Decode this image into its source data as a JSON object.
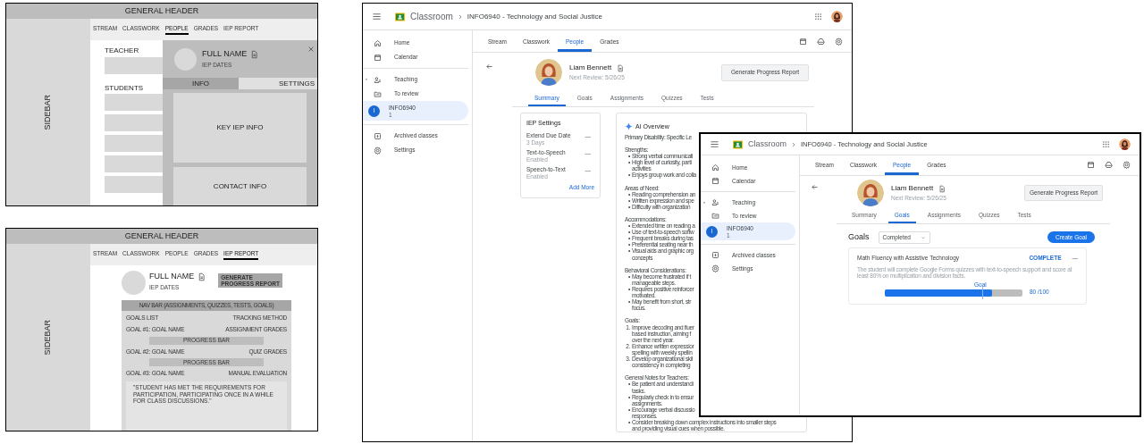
{
  "wireframes": [
    {
      "kind": "people",
      "header": "GENERAL HEADER",
      "sidebar": "SIDEBAR",
      "tabs": [
        {
          "label": "STREAM",
          "selected": false
        },
        {
          "label": "CLASSWORK",
          "selected": false
        },
        {
          "label": "PEOPLE",
          "selected": true
        },
        {
          "label": "GRADES",
          "selected": false
        },
        {
          "label": "IEP REPORT",
          "selected": false
        }
      ],
      "teacher_label": "TEACHER",
      "students_label": "STUDENTS",
      "profile": {
        "name": "FULL NAME",
        "dates": "IEP DATES"
      },
      "panel_tabs": [
        {
          "label": "INFO",
          "selected": true
        },
        {
          "label": "SETTINGS",
          "selected": false
        }
      ],
      "sections": [
        "KEY IEP INFO",
        "CONTACT INFO"
      ]
    },
    {
      "kind": "report",
      "header": "GENERAL HEADER",
      "sidebar": "SIDEBAR",
      "tabs": [
        {
          "label": "STREAM",
          "selected": false
        },
        {
          "label": "CLASSWORK",
          "selected": false
        },
        {
          "label": "PEOPLE",
          "selected": false
        },
        {
          "label": "GRADES",
          "selected": false
        },
        {
          "label": "IEP REPORT",
          "selected": true
        }
      ],
      "profile": {
        "name": "FULL NAME",
        "dates": "IEP DATES"
      },
      "button": "GENERATE PROGRESS REPORT",
      "nav_bar": "NAV BAR (ASSIGNMENTS, QUIZZES, TESTS, GOALS)",
      "goal_rows": [
        {
          "kind": "row",
          "left": "GOALS LIST",
          "right": "TRACKING METHOD"
        },
        {
          "kind": "row",
          "left": "GOAL #1: GOAL NAME",
          "right": "ASSIGNMENT GRADES"
        },
        {
          "kind": "bar",
          "label": "PROGRESS BAR"
        },
        {
          "kind": "row",
          "left": "GOAL #2: GOAL NAME",
          "right": "QUIZ GRADES"
        },
        {
          "kind": "bar",
          "label": "PROGRESS BAR"
        },
        {
          "kind": "row",
          "left": "GOAL #3: GOAL NAME",
          "right": "MANUAL EVALUATION"
        }
      ],
      "quote": "\"STUDENT HAS MET THE REQUIREMENTS FOR PARTICIPATION, PARTICIPATING ONCE IN A WHILE FOR CLASS DISCUSSIONS.\""
    }
  ],
  "screens": [
    {
      "kind": "summary",
      "app": "Classroom",
      "course": "INFO6940 - Technology and Social Justice",
      "sidebar": {
        "groups": [
          {
            "items": [
              {
                "label": "Home",
                "selected": false
              },
              {
                "label": "Calendar",
                "selected": false
              }
            ]
          },
          {
            "items": [
              {
                "label": "Teaching",
                "selected": false
              },
              {
                "label": "To review",
                "selected": false
              },
              {
                "label": "INFO6940",
                "sub": "1",
                "badge": "I",
                "selected": true
              }
            ]
          },
          {
            "items": [
              {
                "label": "Archived classes",
                "selected": false
              },
              {
                "label": "Settings",
                "selected": false
              }
            ]
          }
        ]
      },
      "tabs": [
        {
          "label": "Stream",
          "selected": false
        },
        {
          "label": "Classwork",
          "selected": false
        },
        {
          "label": "People",
          "selected": true
        },
        {
          "label": "Grades",
          "selected": false
        }
      ],
      "student": {
        "name": "Liam Bennett",
        "review": "Next Review: 5/26/25",
        "button": "Generate Progress Report"
      },
      "subtabs": [
        {
          "label": "Summary",
          "selected": true
        },
        {
          "label": "Goals",
          "selected": false
        },
        {
          "label": "Assignments",
          "selected": false
        },
        {
          "label": "Quizzes",
          "selected": false
        },
        {
          "label": "Tests",
          "selected": false
        }
      ],
      "iep_settings": {
        "title": "IEP Settings",
        "items": [
          {
            "label": "Extend Due Date",
            "sub": "3 Days",
            "value": "—"
          },
          {
            "label": "Text-to-Speech",
            "sub": "Enabled",
            "value": "—"
          },
          {
            "label": "Speech-to-Text",
            "sub": "Enabled",
            "value": "—"
          }
        ],
        "link": "Add More"
      },
      "ai_overview": {
        "title": "AI Overview",
        "primary": "Primary Disability: Specific Le",
        "sections": [
          {
            "heading": "Strengths:",
            "items": [
              {
                "marker": "•",
                "lines": [
                  "Strong verbal communicati"
                ]
              },
              {
                "marker": "•",
                "lines": [
                  "High level of curiosity, parti",
                  "activities"
                ]
              },
              {
                "marker": "•",
                "lines": [
                  "Enjoys group work and colla"
                ]
              }
            ]
          },
          {
            "heading": "Areas of Need:",
            "items": [
              {
                "marker": "•",
                "lines": [
                  "Reading comprehension an"
                ]
              },
              {
                "marker": "•",
                "lines": [
                  "Written expression and spe"
                ]
              },
              {
                "marker": "•",
                "lines": [
                  "Difficulty with organization"
                ]
              }
            ]
          },
          {
            "heading": "Accommodations:",
            "items": [
              {
                "marker": "•",
                "lines": [
                  "Extended time on reading a"
                ]
              },
              {
                "marker": "•",
                "lines": [
                  "Use of text-to-speech softw"
                ]
              },
              {
                "marker": "•",
                "lines": [
                  "Frequent breaks during tas"
                ]
              },
              {
                "marker": "•",
                "lines": [
                  "Preferential seating near th"
                ]
              },
              {
                "marker": "•",
                "lines": [
                  "Visual aids and graphic org",
                  "concepts"
                ]
              }
            ]
          },
          {
            "heading": "Behavioral Considerations:",
            "items": [
              {
                "marker": "•",
                "lines": [
                  "May become frustrated if t",
                  "manageable steps."
                ]
              },
              {
                "marker": "•",
                "lines": [
                  "Requires positive reinforcer",
                  "motivated."
                ]
              },
              {
                "marker": "•",
                "lines": [
                  "May benefit from short, str",
                  "focus."
                ]
              }
            ]
          },
          {
            "heading": "Goals:",
            "items": [
              {
                "marker": "1.",
                "lines": [
                  "Improve decoding and fluer",
                  "based instruction, aiming f",
                  "over the next year."
                ]
              },
              {
                "marker": "2.",
                "lines": [
                  "Enhance written expressior",
                  "spelling with weekly spellin"
                ]
              },
              {
                "marker": "3.",
                "lines": [
                  "Develop organizational skil",
                  "consistency in completing"
                ]
              }
            ]
          },
          {
            "heading": "General Notes for Teachers:",
            "items": [
              {
                "marker": "•",
                "lines": [
                  "Be patient and understandi",
                  "tasks."
                ]
              },
              {
                "marker": "•",
                "lines": [
                  "Regularly check in to ensur",
                  "assignments."
                ]
              },
              {
                "marker": "•",
                "lines": [
                  "Encourage verbal discussio",
                  "responses."
                ]
              },
              {
                "marker": "•",
                "lines": [
                  "Consider breaking down complex instructions into smaller steps",
                  "and providing visual cues when possible."
                ]
              }
            ]
          }
        ]
      }
    },
    {
      "kind": "goals",
      "app": "Classroom",
      "course": "INFO6940 - Technology and Social Justice",
      "sidebar": {
        "groups": [
          {
            "items": [
              {
                "label": "Home",
                "selected": false
              },
              {
                "label": "Calendar",
                "selected": false
              }
            ]
          },
          {
            "items": [
              {
                "label": "Teaching",
                "selected": false
              },
              {
                "label": "To review",
                "selected": false
              },
              {
                "label": "INFO6940",
                "sub": "1",
                "badge": "I",
                "selected": true
              }
            ]
          },
          {
            "items": [
              {
                "label": "Archived classes",
                "selected": false
              },
              {
                "label": "Settings",
                "selected": false
              }
            ]
          }
        ]
      },
      "tabs": [
        {
          "label": "Stream",
          "selected": false
        },
        {
          "label": "Classwork",
          "selected": false
        },
        {
          "label": "People",
          "selected": true
        },
        {
          "label": "Grades",
          "selected": false
        }
      ],
      "student": {
        "name": "Liam Bennett",
        "review": "Next Review: 5/26/25",
        "button": "Generate Progress Report"
      },
      "subtabs": [
        {
          "label": "Summary",
          "selected": false
        },
        {
          "label": "Goals",
          "selected": true
        },
        {
          "label": "Assignments",
          "selected": false
        },
        {
          "label": "Quizzes",
          "selected": false
        },
        {
          "label": "Tests",
          "selected": false
        }
      ],
      "goals": {
        "title": "Goals",
        "filter": "Completed",
        "button": "Create Goal",
        "goal": {
          "title": "Math Fluency with Assistive Technology",
          "status": "COMPLETE",
          "collapse": "—",
          "description": "The student will complete Google Forms quizzes with text-to-speech support and score at least 80% on multiplication and division facts.",
          "marker": "Goal",
          "level": 0.78,
          "reading": "80 /100"
        }
      }
    }
  ]
}
